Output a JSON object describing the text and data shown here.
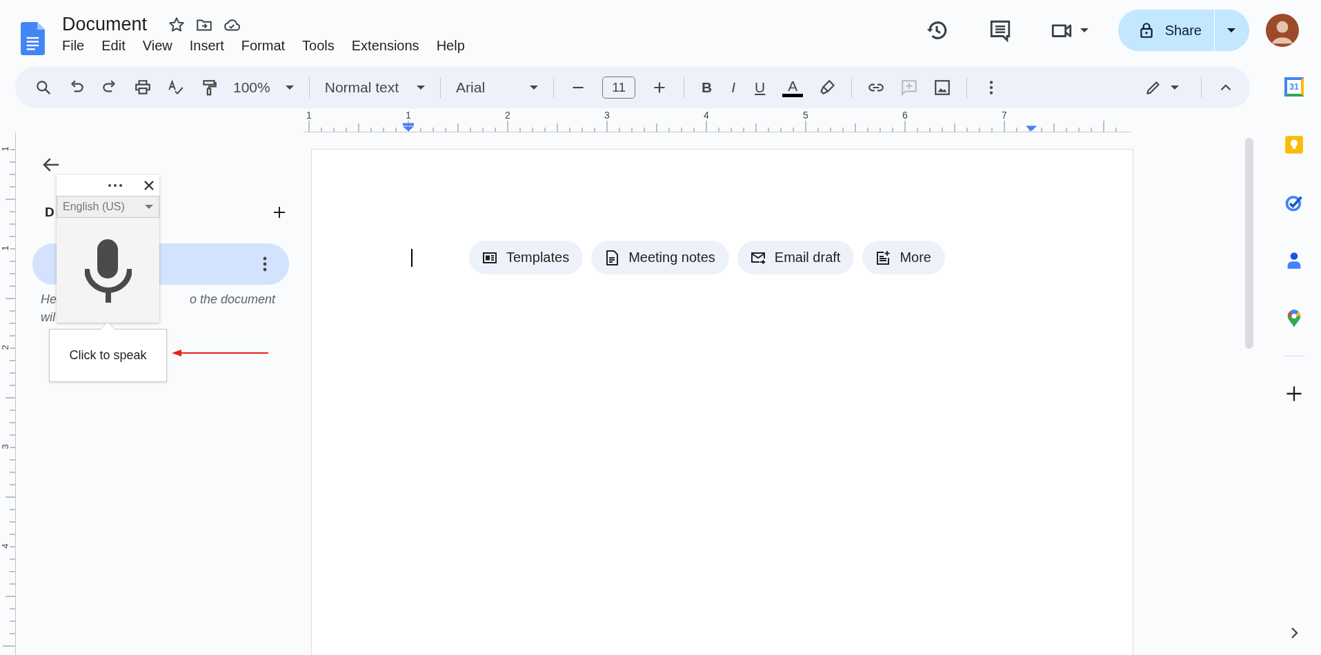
{
  "header": {
    "title": "Document",
    "menu": [
      "File",
      "Edit",
      "View",
      "Insert",
      "Format",
      "Tools",
      "Extensions",
      "Help"
    ],
    "share": "Share"
  },
  "toolbar": {
    "zoom": "100%",
    "style": "Normal text",
    "font": "Arial",
    "font_size": "11",
    "bold": "B",
    "italic": "I",
    "underline": "U",
    "text_color": "A",
    "insert_comment_disabled": true
  },
  "ruler": {
    "labels": [
      "1",
      "1",
      "2",
      "3",
      "4",
      "5",
      "6",
      "7"
    ]
  },
  "vertical_ruler": {
    "labels": [
      "1",
      "1",
      "2",
      "3",
      "4"
    ]
  },
  "side_panel": {
    "heading": "D",
    "tab_selected": true,
    "hint_line_1_start": "He",
    "hint_line_1_end": "o the document",
    "hint_line_2": "wil"
  },
  "voice_popup": {
    "language": "English (US)",
    "tooltip": "Click to speak"
  },
  "chips": [
    "Templates",
    "Meeting notes",
    "Email draft",
    "More"
  ],
  "right_sidebar": {
    "calendar_day": "31"
  }
}
